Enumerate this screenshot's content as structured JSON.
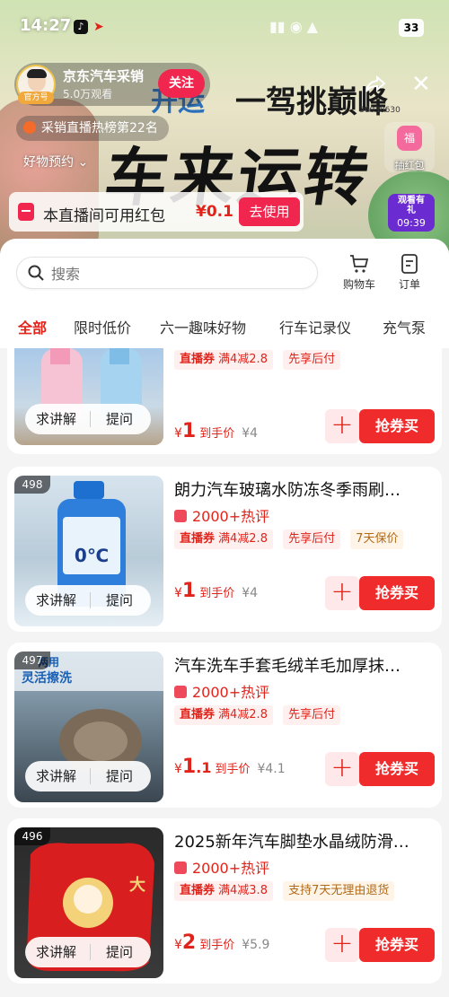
{
  "status_bar": {
    "time": "14:27",
    "battery": "33"
  },
  "stream": {
    "banner_headline": "车来运转",
    "banner_subline": "一驾挑巅峰",
    "banner_arc": "开运",
    "banner_id": "36038630",
    "host_name": "京东汽车采销",
    "host_badge": "官方号",
    "viewers": "5.0万观看",
    "follow_label": "关注",
    "rank_text": "采销直播热榜第22名",
    "preorder_text": "好物预约",
    "redpack_label": "抽红包",
    "redpack_char": "福",
    "watch_label": "观看有礼",
    "watch_timer": "09:39",
    "coupon_text": "本直播间可用红包",
    "coupon_amount": "¥0.1",
    "coupon_use": "去使用"
  },
  "panel": {
    "search_placeholder": "搜索",
    "cart_label": "购物车",
    "order_label": "订单",
    "tabs": [
      "全部",
      "限时低价",
      "六一趣味好物",
      "行车记录仪",
      "充气泵"
    ],
    "active_tab": "全部"
  },
  "colors": {
    "accent": "#e2231a",
    "buy_button": "#f02b2b",
    "follow": "#f0264f"
  },
  "products": [
    {
      "rank": "",
      "title": "",
      "hot": "",
      "tag_coupon_prefix": "直播券",
      "tag_coupon": "满4减2.8",
      "tag2": "先享后付",
      "tag3": "",
      "price_int": "1",
      "price_dec": "",
      "price_label": "到手价",
      "orig_price": "¥4",
      "btn_explain": "求讲解",
      "btn_ask": "提问",
      "btn_buy": "抢券买"
    },
    {
      "rank": "498",
      "title": "朗力汽车玻璃水防冻冬季雨刷…",
      "hot": "2000+热评",
      "tag_coupon_prefix": "直播券",
      "tag_coupon": "满4减2.8",
      "tag2": "先享后付",
      "tag3": "7天保价",
      "price_int": "1",
      "price_dec": "",
      "price_label": "到手价",
      "orig_price": "¥4",
      "btn_explain": "求讲解",
      "btn_ask": "提问",
      "btn_buy": "抢券买"
    },
    {
      "rank": "497",
      "title": "汽车洗车手套毛绒羊毛加厚抹…",
      "hot": "2000+热评",
      "tag_coupon_prefix": "直播券",
      "tag_coupon": "满4减2.8",
      "tag2": "先享后付",
      "tag3": "",
      "price_int": "1",
      "price_dec": ".1",
      "price_label": "到手价",
      "orig_price": "¥4.1",
      "btn_explain": "求讲解",
      "btn_ask": "提问",
      "btn_buy": "抢券买"
    },
    {
      "rank": "496",
      "title": "2025新年汽车脚垫水晶绒防滑…",
      "hot": "2000+热评",
      "tag_coupon_prefix": "直播券",
      "tag_coupon": "满4减3.8",
      "tag2": "支持7天无理由退货",
      "tag3": "",
      "price_int": "2",
      "price_dec": "",
      "price_label": "到手价",
      "orig_price": "¥5.9",
      "btn_explain": "求讲解",
      "btn_ask": "提问",
      "btn_buy": "抢券买"
    }
  ]
}
